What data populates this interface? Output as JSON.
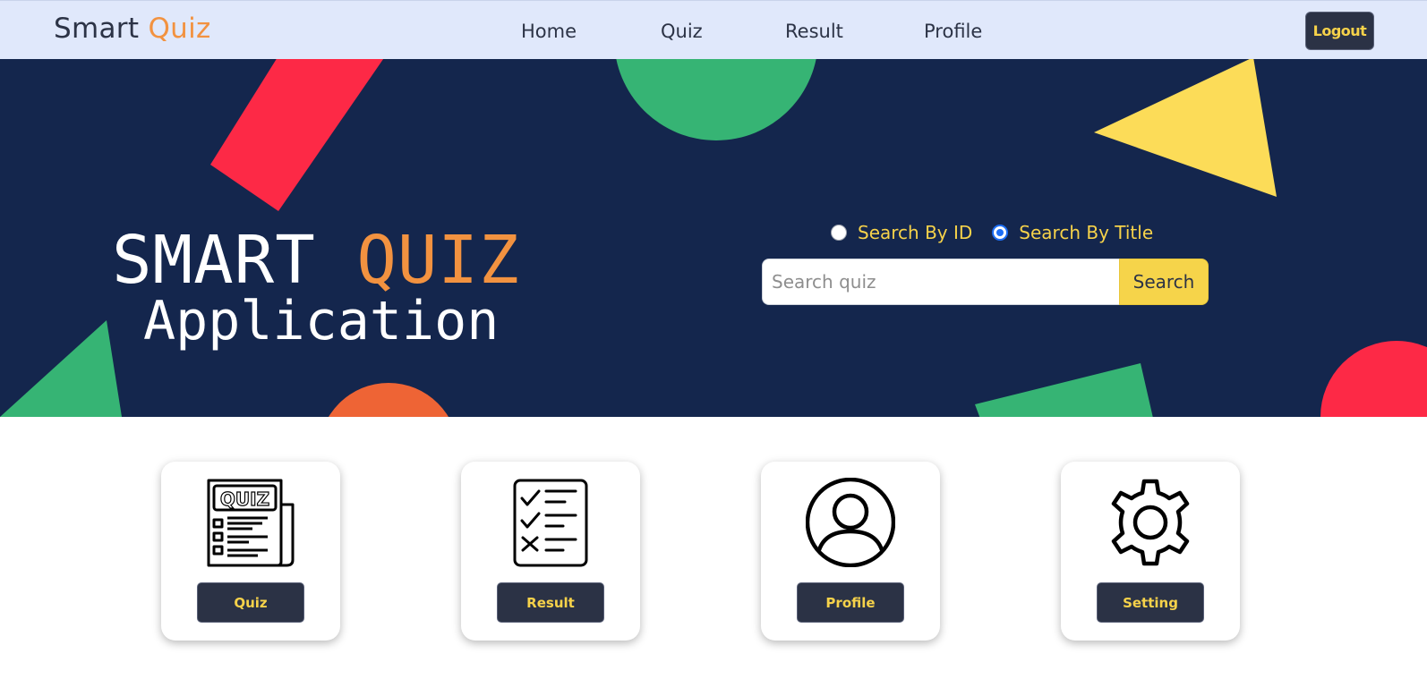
{
  "navbar": {
    "brand_part1": "Smart",
    "brand_part2": "Quiz",
    "links": [
      "Home",
      "Quiz",
      "Result",
      "Profile"
    ],
    "logout_label": "Logout"
  },
  "hero": {
    "title_part1": "SMART",
    "title_part2": "QUIZ",
    "subtitle": "Application",
    "search": {
      "options": [
        {
          "label": "Search By ID",
          "checked": false
        },
        {
          "label": "Search By Title",
          "checked": true
        }
      ],
      "placeholder": "Search quiz",
      "value": "",
      "button_label": "Search"
    }
  },
  "cards": [
    {
      "label": "Quiz",
      "icon": "quiz-newspaper-icon"
    },
    {
      "label": "Result",
      "icon": "checklist-icon"
    },
    {
      "label": "Profile",
      "icon": "user-profile-icon"
    },
    {
      "label": "Setting",
      "icon": "gear-icon"
    }
  ],
  "colors": {
    "navbar_bg": "#e0e8fb",
    "hero_bg": "#14264d",
    "accent_orange": "#f29240",
    "accent_yellow": "#f6d24a",
    "button_dark": "#2b3245"
  }
}
